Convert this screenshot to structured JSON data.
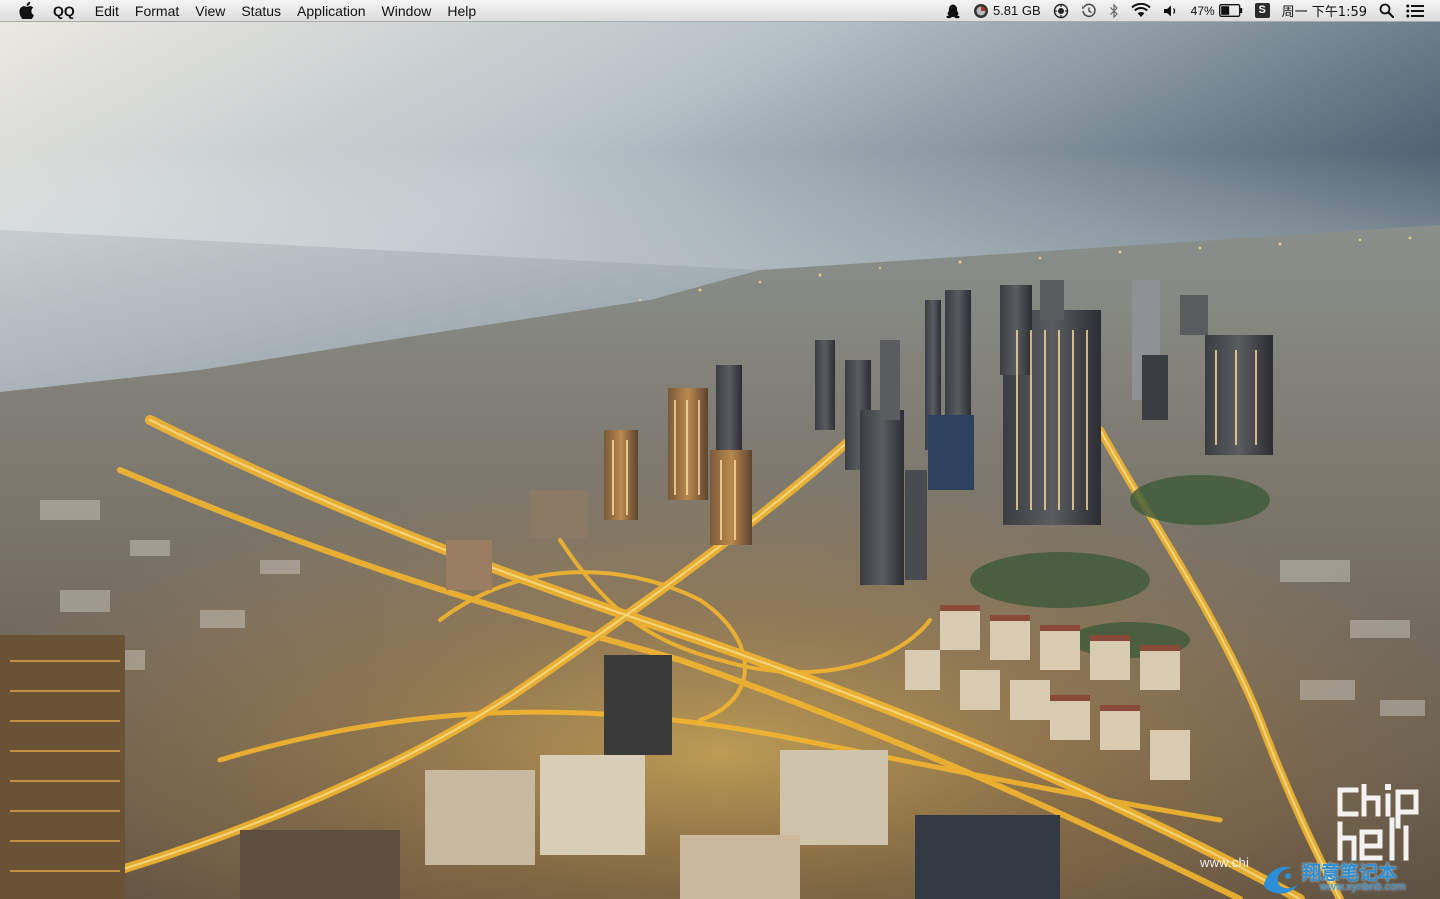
{
  "menubar": {
    "app_name": "QQ",
    "menus": [
      {
        "label": "Edit"
      },
      {
        "label": "Format"
      },
      {
        "label": "View"
      },
      {
        "label": "Status"
      },
      {
        "label": "Application"
      },
      {
        "label": "Window"
      },
      {
        "label": "Help"
      }
    ],
    "status": {
      "qq_icon": "qq-penguin-icon",
      "memory_icon": "memory-gauge-icon",
      "memory_free": "5.81 GB",
      "weather_icon": "sun-icon",
      "time_machine_icon": "time-machine-icon",
      "bluetooth_icon": "bluetooth-icon",
      "wifi_icon": "wifi-icon",
      "volume_icon": "speaker-icon",
      "battery_percent": "47%",
      "battery_level": 0.47,
      "input_method": "S",
      "clock": "周一 下午1:59",
      "spotlight_icon": "magnifier-icon",
      "notification_icon": "list-icon"
    }
  },
  "desktop": {
    "wallpaper": "city-aerial-dusk",
    "watermarks": {
      "chiphell_logo_line1": "chip",
      "chiphell_logo_line2": "hell",
      "chiphell_url": "www.chi",
      "xynbnb_title": "翔意笔记本",
      "xynbnb_url": "www.xynbnb.com"
    }
  },
  "colors": {
    "menubar_top": "#f4f4f4",
    "menubar_bottom": "#dcdcdc",
    "watermark_blue": "#2a8fd6",
    "city_light": "#f0b830"
  }
}
